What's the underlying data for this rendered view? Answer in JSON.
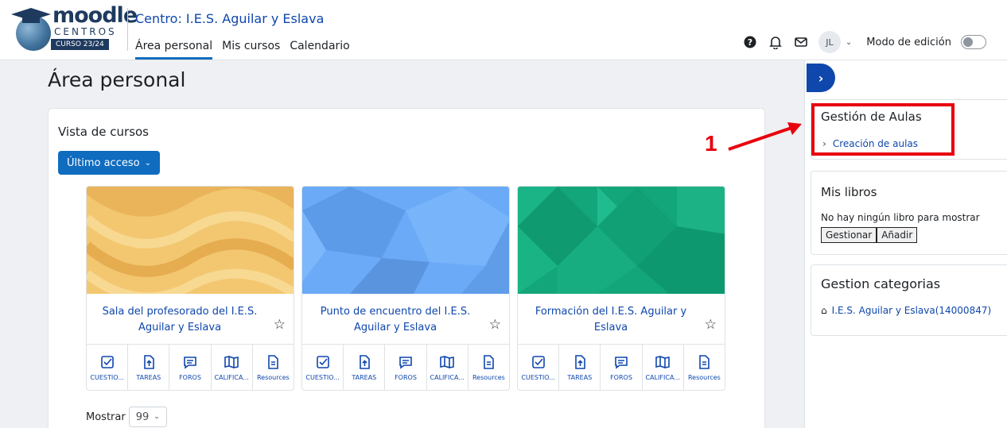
{
  "header": {
    "brand": "moodle",
    "brand_sub": "CENTROS",
    "course_year": "CURSO 23/24",
    "center_title": "Centro: I.E.S. Aguilar y Eslava",
    "nav": [
      "Área personal",
      "Mis cursos",
      "Calendario"
    ],
    "active_nav": "Área personal",
    "user_initials": "JL",
    "edit_mode_label": "Modo de edición",
    "edit_mode_on": false,
    "icons": [
      "help-icon",
      "bell-icon",
      "mail-icon"
    ]
  },
  "main": {
    "page_title": "Área personal",
    "section_title": "Vista de cursos",
    "sort_button": "Último acceso",
    "courses": [
      {
        "name": "Sala del profesorado del I.E.S. Aguilar y Eslava",
        "image_color": "#f2c46e"
      },
      {
        "name": "Punto de encuentro del I.E.S. Aguilar y Eslava",
        "image_color": "#6baaf5"
      },
      {
        "name": "Formación del I.E.S. Aguilar y Eslava",
        "image_color": "#12a579"
      }
    ],
    "tools": [
      "CUESTIO...",
      "TAREAS",
      "FOROS",
      "CALIFICA...",
      "Resources"
    ],
    "show_label": "Mostrar",
    "show_value": "99"
  },
  "drawer": {
    "block1": {
      "title": "Gestión de Aulas",
      "link": "Creación de aulas"
    },
    "block2": {
      "title": "Mis libros",
      "message": "No hay ningún libro para mostrar",
      "manage_button": "Gestionar",
      "add_button": "Añadir"
    },
    "block3": {
      "title": "Gestion categorias",
      "link": "I.E.S. Aguilar y Eslava(14000847)"
    }
  },
  "annotation": {
    "number": "1",
    "color": "#e8000d"
  }
}
